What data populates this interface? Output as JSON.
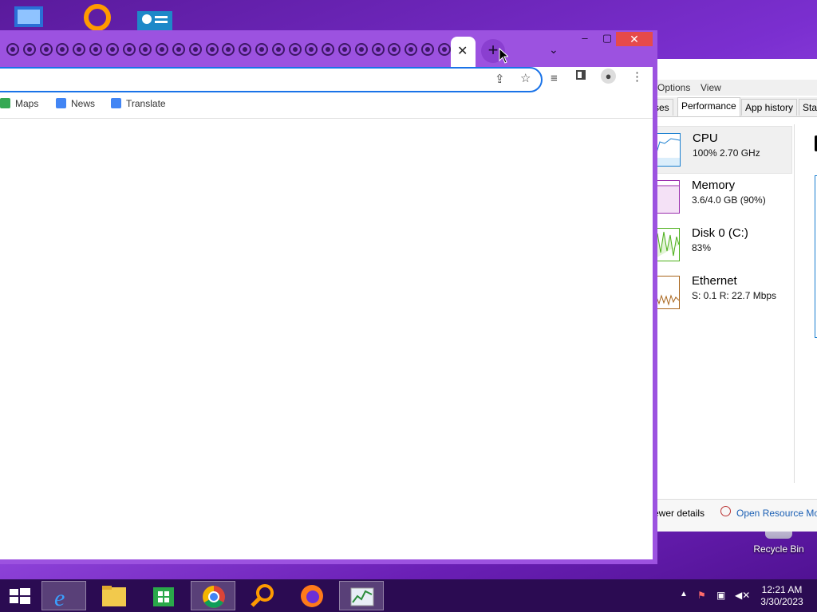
{
  "desktop": {
    "recycle_bin_label": "Recycle Bin"
  },
  "task_manager": {
    "menu": [
      "Options",
      "View"
    ],
    "tabs": [
      "ses",
      "Performance",
      "App history",
      "Star"
    ],
    "active_tab": "Performance",
    "resources": [
      {
        "name": "CPU",
        "value": "100%  2.70 GHz",
        "color": "#1a7fd0"
      },
      {
        "name": "Memory",
        "value": "3.6/4.0 GB (90%)",
        "color": "#9b2fae"
      },
      {
        "name": "Disk 0 (C:)",
        "value": "83%",
        "color": "#4caf1a"
      },
      {
        "name": "Ethernet",
        "value": "S: 0.1  R: 22.7 Mbps",
        "color": "#a8641a"
      }
    ],
    "fewer_details": "ewer details",
    "open_resource_monitor": "Open Resource Mo"
  },
  "chrome": {
    "close_tab_label": "✕",
    "new_tab_label": "+",
    "tab_search_label": "⌄",
    "minimize_label": "–",
    "maximize_label": "▢",
    "close_label": "✕",
    "omnibox_value": "",
    "bookmarks": [
      {
        "label": "Maps",
        "color": "#34a853"
      },
      {
        "label": "News",
        "color": "#4285f4"
      },
      {
        "label": "Translate",
        "color": "#4285f4"
      }
    ]
  },
  "taskbar": {
    "time": "12:21 AM",
    "date": "3/30/2023"
  },
  "colors": {
    "accent": "#9c52e0",
    "taskbar": "#2b0b52",
    "close": "#e64a4a"
  }
}
